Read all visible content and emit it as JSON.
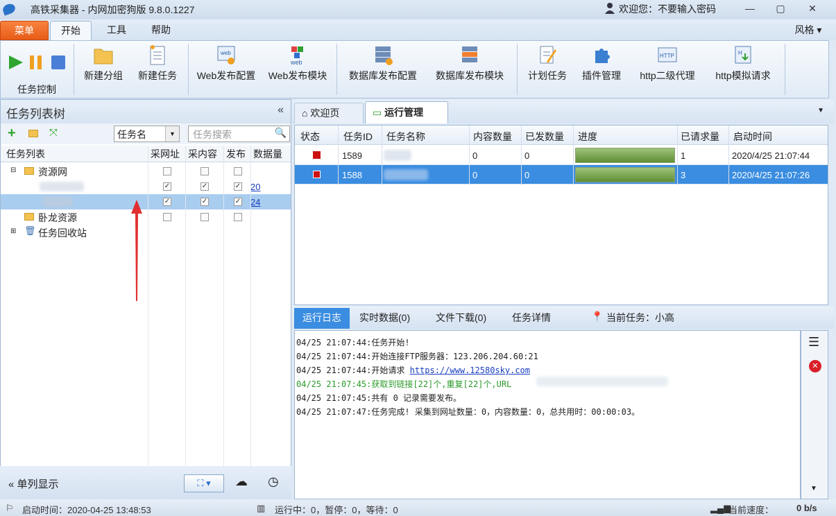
{
  "window": {
    "title": "高铁采集器 - 内网加密狗版 9.8.0.1227",
    "welcome": "欢迎您：不要输入密码"
  },
  "menu": {
    "caidan": "菜单",
    "kaishi": "开始",
    "gongju": "工具",
    "bangzhu": "帮助",
    "style": "风格"
  },
  "ribbon": {
    "buttons": [
      "新建分组",
      "新建任务",
      "Web发布配置",
      "Web发布模块",
      "数据库发布配置",
      "数据库发布模块",
      "计划任务",
      "插件管理",
      "http二级代理",
      "http模拟请求"
    ],
    "group_label": "任务控制"
  },
  "left": {
    "title": "任务列表树",
    "select_value": "任务名",
    "search_placeholder": "任务搜索",
    "headers": [
      "任务列表",
      "采网址",
      "采内容",
      "发布",
      "数据量"
    ],
    "rows": [
      {
        "label": "资源网",
        "count": ""
      },
      {
        "label": "",
        "count": "20"
      },
      {
        "label": "",
        "count": "24"
      },
      {
        "label": "卧龙资源",
        "count": ""
      },
      {
        "label": "任务回收站",
        "count": ""
      }
    ],
    "footer_label": "单列显示"
  },
  "tabs": {
    "welcome": "欢迎页",
    "running": "运行管理"
  },
  "grid": {
    "headers": [
      "状态",
      "任务ID",
      "任务名称",
      "内容数量",
      "已发数量",
      "进度",
      "已请求量",
      "启动时间"
    ],
    "rows": [
      {
        "id": "1589",
        "content": "0",
        "sent": "0",
        "progress": 1,
        "requests": "1",
        "start": "2020/4/25 21:07:44"
      },
      {
        "id": "1588",
        "content": "0",
        "sent": "0",
        "progress": 1,
        "requests": "3",
        "start": "2020/4/25 21:07:26"
      }
    ]
  },
  "logtabs": {
    "log": "运行日志",
    "realtime": "实时数据(0)",
    "download": "文件下载(0)",
    "detail": "任务详情",
    "current": "当前任务：小高"
  },
  "log": [
    {
      "text": "04/25 21:07:44:任务开始!",
      "color": "#222"
    },
    {
      "text": "04/25 21:07:44:开始连接FTP服务器：123.206.204.60:21",
      "color": "#222"
    },
    {
      "text": "04/25 21:07:44:开始请求 ",
      "link": "https://www.12580sky.com",
      "color": "#222"
    },
    {
      "text": "04/25 21:07:45:获取到链接[22]个,重复[22]个,URL",
      "color": "#2a9a2a"
    },
    {
      "text": "04/25 21:07:45:共有 0 记录需要发布。",
      "color": "#222"
    },
    {
      "text": "04/25 21:07:47:任务完成! 采集到网址数量：0，内容数量：0，总共用时：00:00:03。",
      "color": "#222"
    }
  ],
  "status": {
    "start": "启动时间：2020-04-25 13:48:53",
    "running": "运行中：0，暂停：0，等待：0",
    "speed_label": "当前速度：",
    "speed": "0 b/s"
  },
  "colors": {
    "accent": "#3a8de0",
    "selected_row": "#3a8de0",
    "stop": "#cc1111"
  }
}
